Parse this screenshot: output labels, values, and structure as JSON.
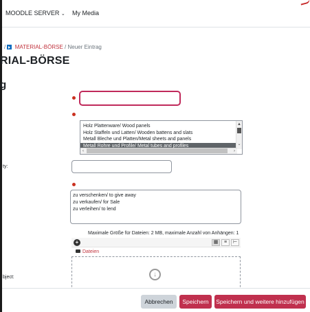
{
  "topnav": {
    "items": [
      "MOODLE SERVER",
      "My Media"
    ]
  },
  "breadcrumb": {
    "separator": "/",
    "activity": "MATERIAL-BÖRSE",
    "current": "Neuer Eintrag"
  },
  "page_title": "RIAL-BÖRSE",
  "section_title": "g",
  "form": {
    "field1_value": "",
    "categories": {
      "options": [
        "Holz Plattenware/ Wood panels",
        "Holz Staffeln und Latten/ Wooden battens and slats",
        "Metall Bleche und Platten/Metal sheets and panels",
        "Metall Rohre und Profile/ Metal tubes and profiles"
      ]
    },
    "quantity_label": "ty:",
    "quantity_value": "",
    "type_options": [
      "zu verschenken/ to give away",
      "zu verkaufen/ for Sale",
      "zu verleihen/ to lend"
    ],
    "file_info": "Maximale Größe für Dateien: 2 MB, maximale Anzahl von Anhängen: 1",
    "folder_label": "Dateien",
    "object_label": "bject:"
  },
  "buttons": {
    "cancel": "Abbrechen",
    "save": "Speichern",
    "save_add": "Speichern und weitere hinzufügen"
  },
  "colors": {
    "brand": "#c0304e",
    "required": "#ca3120",
    "link": "#c0323c"
  }
}
